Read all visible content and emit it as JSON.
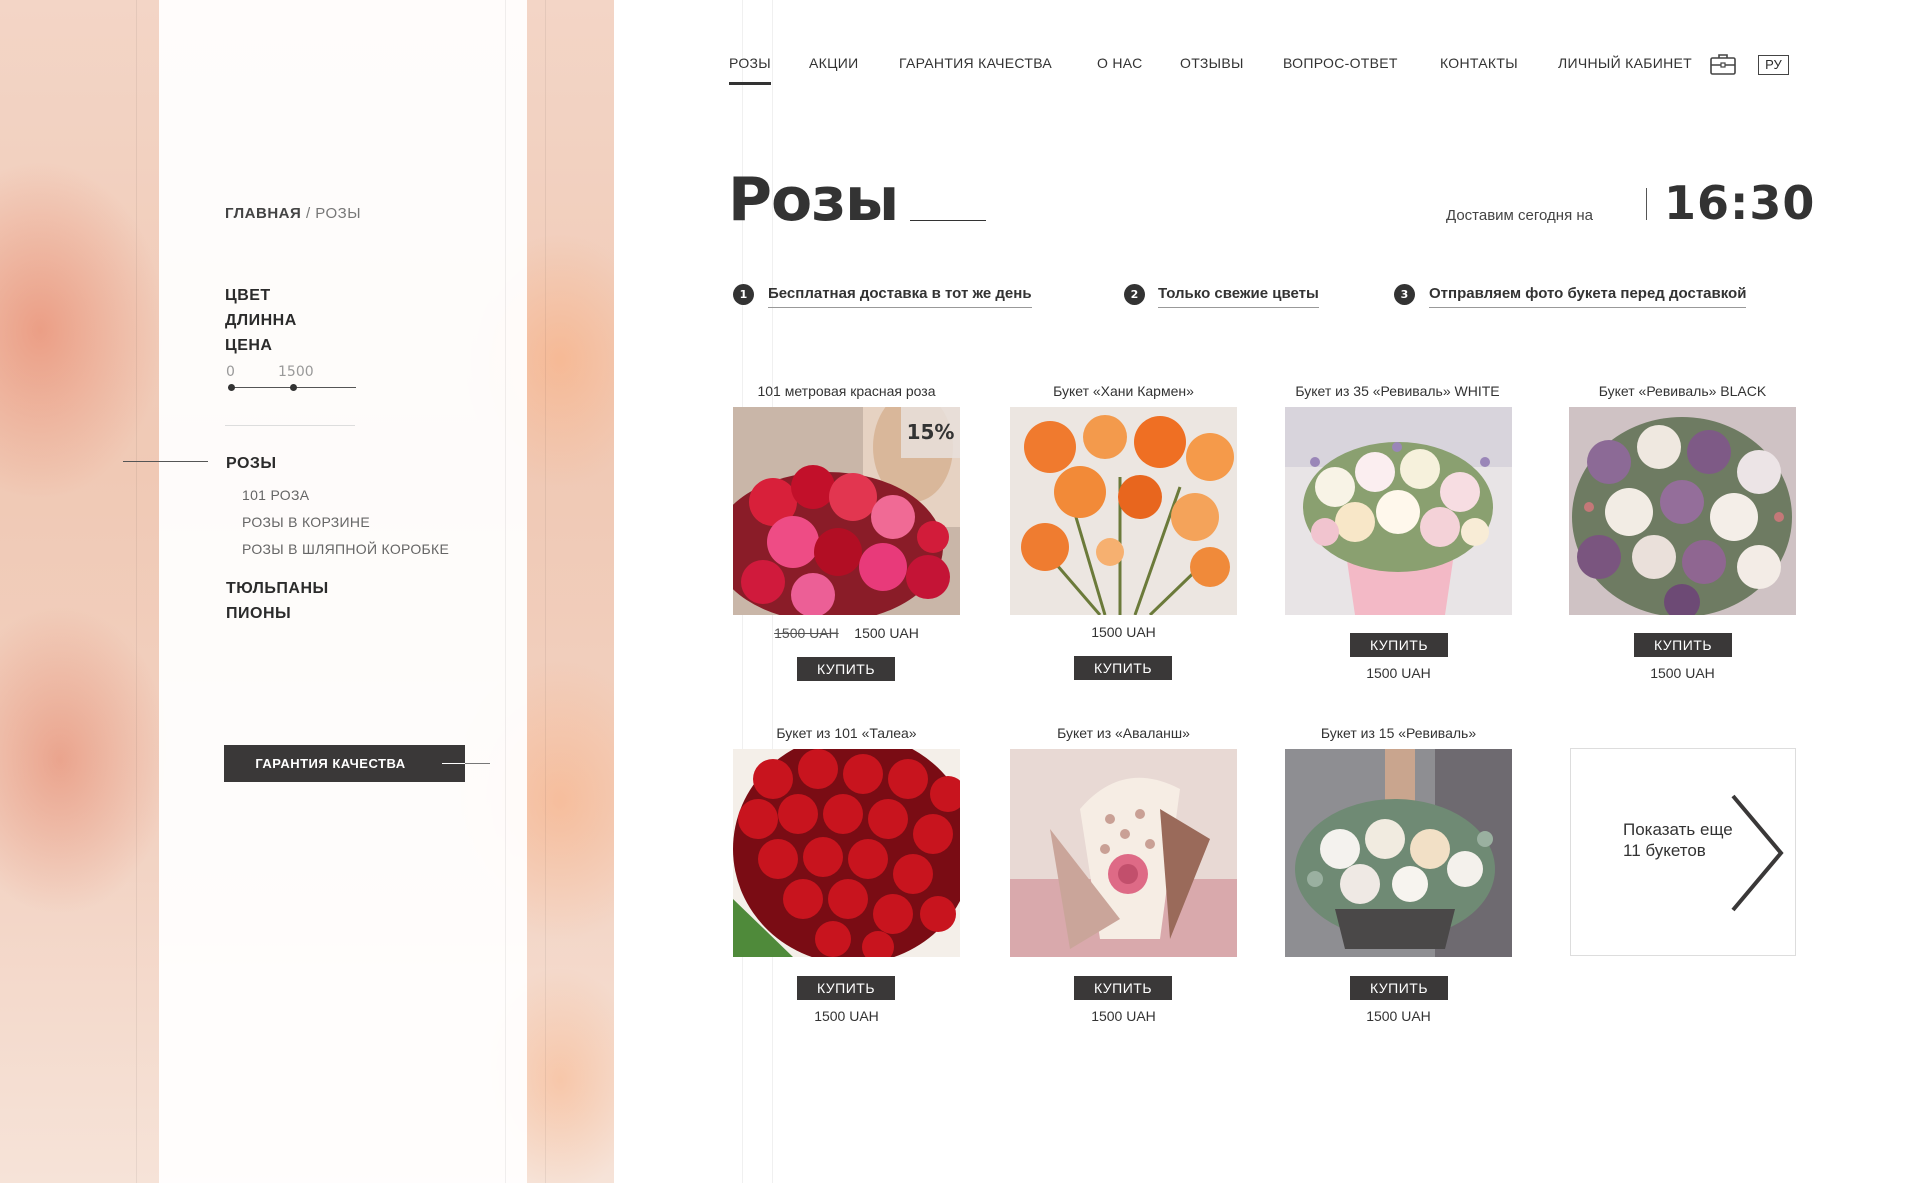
{
  "nav": {
    "items": [
      "РОЗЫ",
      "АКЦИИ",
      "ГАРАНТИЯ КАЧЕСТВА",
      "О НАС",
      "ОТЗЫВЫ",
      "ВОПРОС-ОТВЕТ",
      "КОНТАКТЫ",
      "ЛИЧНЫЙ КАБИНЕТ"
    ],
    "active": "РОЗЫ",
    "cabinet_icon": "briefcase-icon",
    "lang": "РУ"
  },
  "breadcrumb": {
    "home": "ГЛАВНАЯ",
    "separator": " / ",
    "current": "РОЗЫ"
  },
  "filters": {
    "items": [
      "ЦВЕТ",
      "ДЛИННА",
      "ЦЕНА"
    ],
    "price_min": "0",
    "price_max": "1500"
  },
  "categories": {
    "main": [
      "РОЗЫ",
      "ТЮЛЬПАНЫ",
      "ПИОНЫ"
    ],
    "sub": [
      "101 РОЗА",
      "РОЗЫ В КОРЗИНЕ",
      "РОЗЫ В ШЛЯПНОЙ КОРОБКЕ"
    ]
  },
  "quality_button": "ГАРАНТИЯ КАЧЕСТВА",
  "page": {
    "title": "Розы"
  },
  "delivery": {
    "text": "Доставим сегодня на",
    "time": "16:30"
  },
  "features": [
    {
      "num": "1",
      "text": "Бесплатная доставка в тот же день"
    },
    {
      "num": "2",
      "text": "Только свежие цветы"
    },
    {
      "num": "3",
      "text": "Отправляем фото букета перед  доставкой"
    }
  ],
  "products": [
    {
      "name": "101 метровая красная роза",
      "old_price": "1500 UAH",
      "price": "1500 UAH",
      "discount": "15%",
      "buy": "КУПИТЬ",
      "image": "red-pink-bouquet"
    },
    {
      "name": "Букет «Хани Кармен»",
      "price": "1500 UAH",
      "buy": "КУПИТЬ",
      "image": "orange-roses"
    },
    {
      "name": "Букет из 35 «Ревиваль» WHITE",
      "price": "1500 UAH",
      "buy": "КУПИТЬ",
      "image": "white-hatbox-bouquet"
    },
    {
      "name": "Букет «Ревиваль» BLACK",
      "price": "1500 UAH",
      "buy": "КУПИТЬ",
      "image": "purple-white-bouquet"
    },
    {
      "name": "Букет из 101 «Талеа»",
      "price": "1500 UAH",
      "buy": "КУПИТЬ",
      "image": "red-roses-bunch"
    },
    {
      "name": "Букет из «Аваланш»",
      "price": "1500 UAH",
      "buy": "КУПИТЬ",
      "image": "pink-wrapped-bouquet"
    },
    {
      "name": "Букет из 15 «Ревиваль»",
      "price": "1500 UAH",
      "buy": "КУПИТЬ",
      "image": "basket-bouquet"
    }
  ],
  "show_more": {
    "text": "Показать еще 11 букетов",
    "icon": "chevron-right-icon"
  }
}
